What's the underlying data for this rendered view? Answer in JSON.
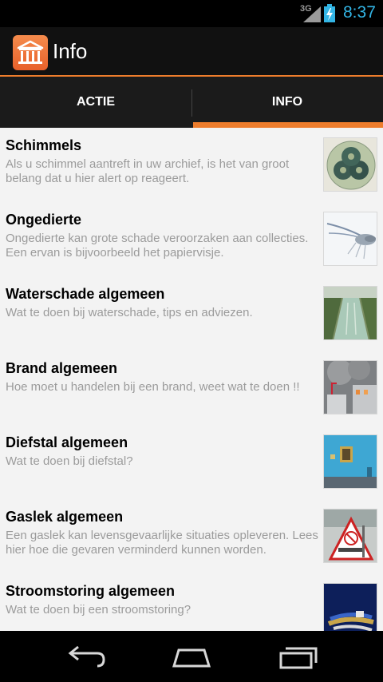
{
  "status": {
    "network": "3G",
    "time": "8:37"
  },
  "app": {
    "title": "Info"
  },
  "tabs": [
    {
      "label": "ACTIE"
    },
    {
      "label": "INFO"
    }
  ],
  "items": [
    {
      "title": "Schimmels",
      "description": "Als u schimmel aantreft in uw archief, is het van groot belang dat u hier alert op reageert."
    },
    {
      "title": "Ongedierte",
      "description": "Ongedierte kan grote schade veroorzaken aan collecties. Een ervan is bijvoorbeeld het papiervisje."
    },
    {
      "title": "Waterschade algemeen",
      "description": "Wat te doen bij waterschade, tips en adviezen."
    },
    {
      "title": "Brand algemeen",
      "description": " Hoe moet u handelen bij een brand, weet wat te doen !!"
    },
    {
      "title": "Diefstal algemeen",
      "description": "Wat te doen bij diefstal?"
    },
    {
      "title": "Gaslek algemeen",
      "description": "Een gaslek kan levensgevaarlijke situaties opleveren. Lees hier hoe die gevaren verminderd kunnen worden."
    },
    {
      "title": "Stroomstoring algemeen",
      "description": "Wat te doen bij een stroomstoring?"
    }
  ],
  "colors": {
    "accent": "#ee7d2c",
    "time": "#33b5e5"
  },
  "icons": {
    "app": "archive-building-icon",
    "back": "back-icon",
    "home": "home-icon",
    "recents": "recent-apps-icon"
  }
}
